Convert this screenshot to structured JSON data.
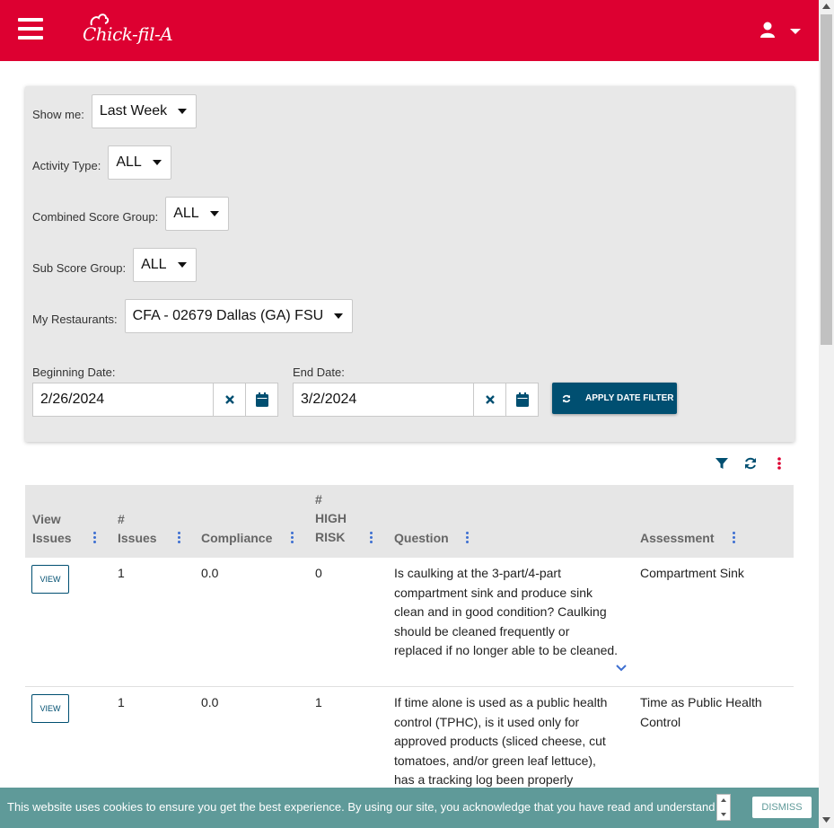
{
  "header": {
    "brand": "Chick-fil-A",
    "menu_icon": "hamburger-icon",
    "user_icon": "user-icon"
  },
  "filters": {
    "show_me": {
      "label": "Show me:",
      "value": "Last Week"
    },
    "activity_type": {
      "label": "Activity Type:",
      "value": "ALL"
    },
    "combined_score_group": {
      "label": "Combined Score Group:",
      "value": "ALL"
    },
    "sub_score_group": {
      "label": "Sub Score Group:",
      "value": "ALL"
    },
    "my_restaurants": {
      "label": "My Restaurants:",
      "value": "CFA - 02679 Dallas (GA) FSU"
    },
    "beginning_date": {
      "label": "Beginning Date:",
      "value": "2/26/2024"
    },
    "end_date": {
      "label": "End Date:",
      "value": "3/2/2024"
    },
    "apply_label": "APPLY DATE FILTER"
  },
  "table": {
    "columns": [
      {
        "line1": "View",
        "line2": "Issues"
      },
      {
        "line1": "#",
        "line2": "Issues"
      },
      {
        "line1": "",
        "line2": "Compliance"
      },
      {
        "line0": "#",
        "line1": "HIGH",
        "line2": "RISK"
      },
      {
        "line1": "",
        "line2": "Question"
      },
      {
        "line1": "",
        "line2": "Assessment"
      }
    ],
    "rows": [
      {
        "view": "VIEW",
        "issues": "1",
        "compliance": "0.0",
        "high_risk": "0",
        "question": [
          "Is caulking at the 3-part/4-part",
          "compartment sink and produce sink",
          "clean and in good condition? Caulking",
          "should be cleaned frequently or",
          "replaced if no longer able to be cleaned."
        ],
        "assessment": [
          "Compartment Sink"
        ]
      },
      {
        "view": "VIEW",
        "issues": "1",
        "compliance": "0.0",
        "high_risk": "1",
        "question": [
          "If time alone is used as a public health",
          "control (TPHC), is it used only for",
          "approved products (sliced cheese, cut",
          "tomatoes, and/or green leaf lettuce),",
          "has a tracking log been properly"
        ],
        "assessment": [
          "Time as Public Health",
          "Control"
        ]
      }
    ]
  },
  "cookie": {
    "text": "This website uses cookies to ensure you get the best experience. By using our site, you acknowledge that you have read and understand",
    "dismiss": "DISMISS"
  },
  "colors": {
    "brand_red": "#dd0031",
    "navy": "#004f71",
    "cookie_teal": "#5f9a99",
    "menu_blue": "#3d6fd1"
  }
}
